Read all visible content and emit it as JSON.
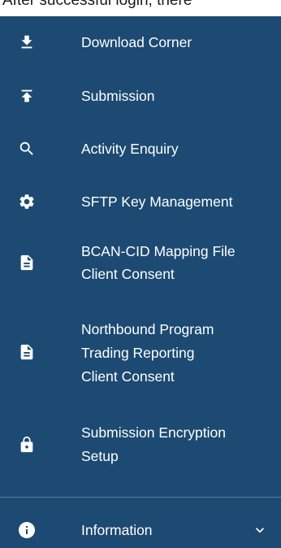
{
  "caption": {
    "text": "After successful login, there"
  },
  "sidebar": {
    "background": "#1c4a72",
    "items": [
      {
        "icon": "download-icon",
        "lines": [
          "Download Corner"
        ]
      },
      {
        "icon": "upload-icon",
        "lines": [
          "Submission"
        ]
      },
      {
        "icon": "search-icon",
        "lines": [
          "Activity Enquiry"
        ]
      },
      {
        "icon": "gear-icon",
        "lines": [
          "SFTP Key Management"
        ]
      },
      {
        "icon": "document-icon",
        "lines": [
          "BCAN-CID Mapping File",
          "Client Consent"
        ]
      },
      {
        "icon": "document-icon",
        "lines": [
          "Northbound Program",
          "Trading Reporting",
          "Client Consent"
        ]
      },
      {
        "icon": "lock-icon",
        "lines": [
          "Submission Encryption",
          "Setup"
        ]
      }
    ],
    "information": {
      "icon": "info-icon",
      "label": "Information",
      "toggle_icon": "chevron-down-icon"
    }
  }
}
